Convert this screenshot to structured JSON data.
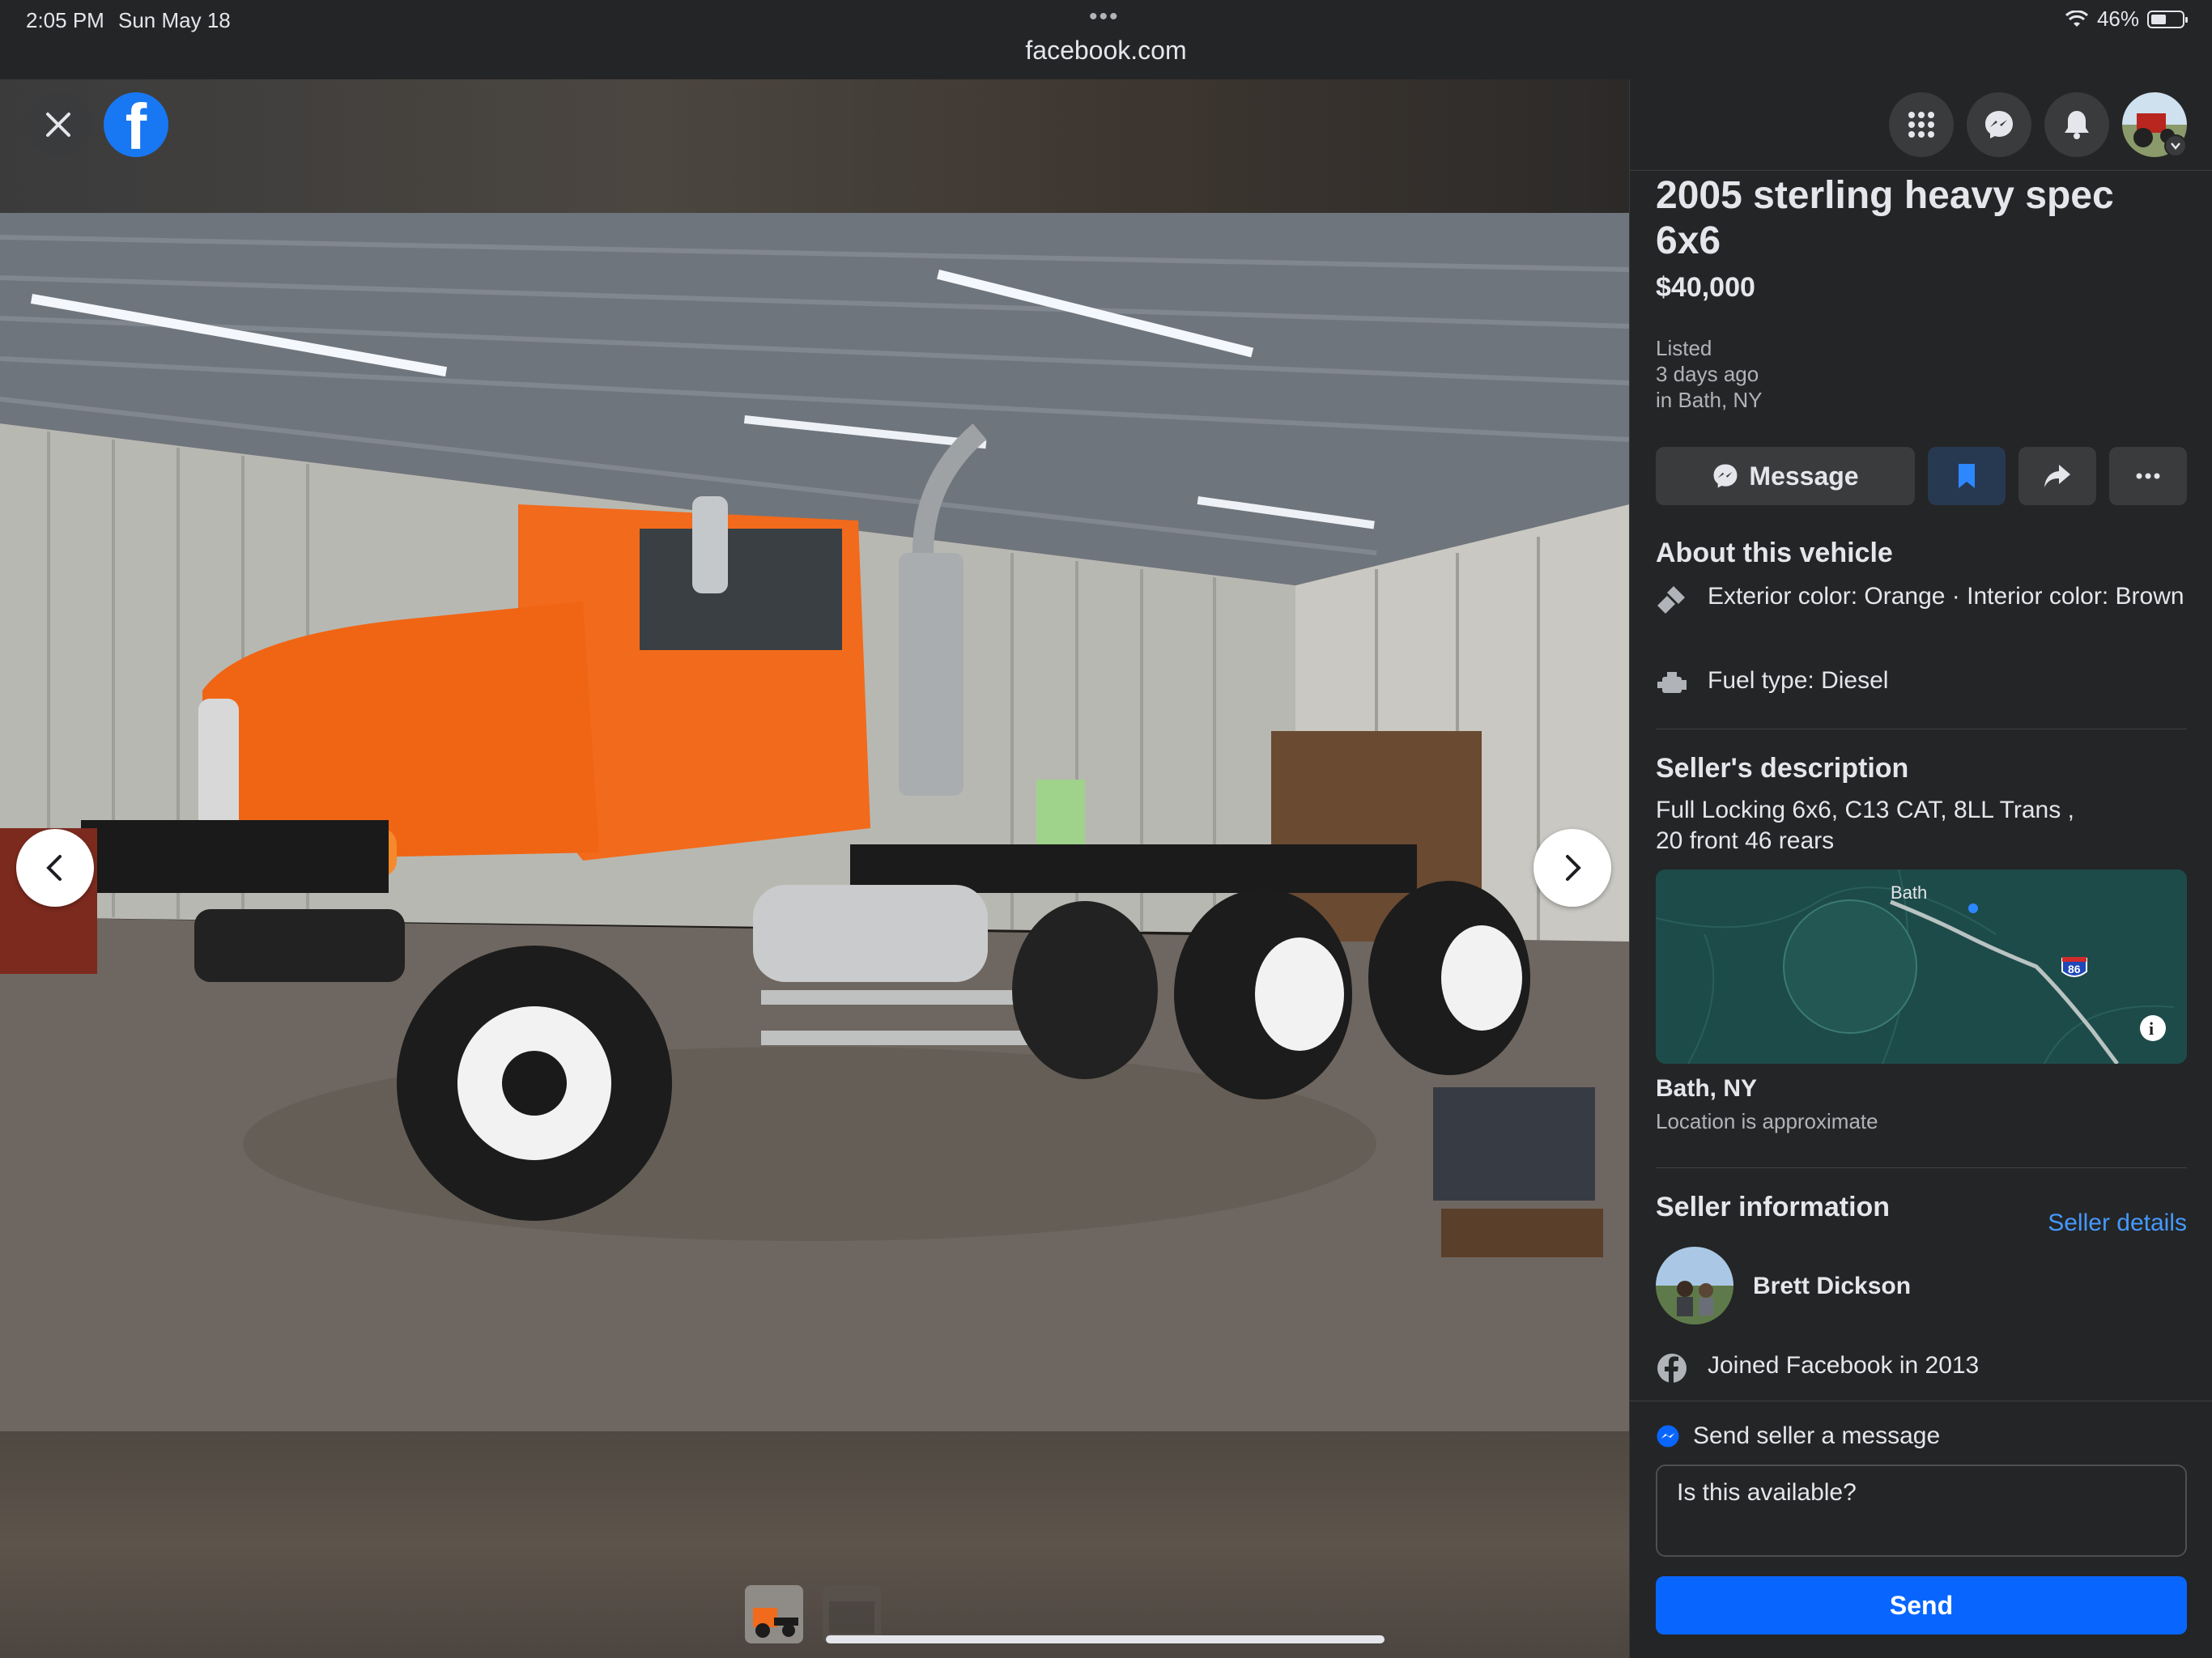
{
  "status_bar": {
    "time": "2:05 PM",
    "date": "Sun May 18",
    "battery": "46%",
    "battery_level": 0.46,
    "url": "facebook.com"
  },
  "viewer": {
    "close_label": "Close",
    "logo_letter": "f"
  },
  "topbar": {
    "icons": [
      "menu-grid-icon",
      "messenger-icon",
      "bell-icon",
      "account-avatar"
    ]
  },
  "listing": {
    "title": "2005 sterling heavy spec 6x6",
    "price": "$40,000",
    "listed_line1": "Listed",
    "listed_line2": "3 days ago",
    "listed_line3": "in Bath, NY"
  },
  "actions": {
    "message_label": "Message"
  },
  "about": {
    "heading": "About this vehicle",
    "color_text": "Exterior color: Orange · Interior color: Brown",
    "fuel_text": "Fuel type: Diesel"
  },
  "description": {
    "heading": "Seller's description",
    "text_line1": "Full Locking 6x6, C13 CAT, 8LL Trans ,",
    "text_line2": "20 front 46 rears"
  },
  "map": {
    "label": "Bath",
    "highway": "86"
  },
  "location": {
    "name": "Bath, NY",
    "note": "Location is approximate"
  },
  "seller": {
    "heading": "Seller information",
    "details_link": "Seller details",
    "name": "Brett Dickson",
    "joined": "Joined Facebook in 2013"
  },
  "message_box": {
    "label": "Send seller a message",
    "input_value": "Is this available?",
    "send_label": "Send"
  },
  "colors": {
    "accent": "#0866ff",
    "link": "#4599ff",
    "truck": "#f26a1b",
    "panel_bg": "#242526"
  }
}
